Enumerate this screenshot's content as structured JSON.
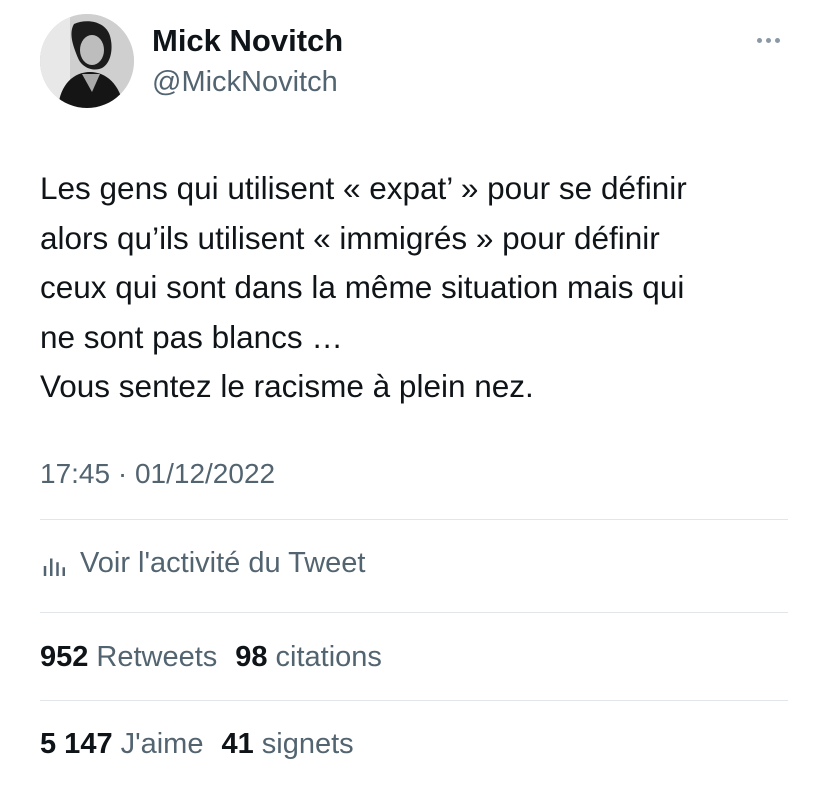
{
  "author": {
    "display_name": "Mick Novitch",
    "handle": "@MickNovitch",
    "avatar_icon": "profile-photo-avatar"
  },
  "more_icon": "more-dots-icon",
  "tweet": {
    "lines": [
      "Les gens qui utilisent « expat’ » pour se définir",
      "alors qu’ils utilisent « immigrés » pour définir",
      "ceux qui sont dans la même situation mais qui",
      "ne sont pas blancs …",
      "Vous sentez le racisme à plein nez."
    ],
    "timestamp": "17:45 · 01/12/2022"
  },
  "activity": {
    "icon": "analytics-bars-icon",
    "label": "Voir l'activité du Tweet"
  },
  "stats": {
    "retweets_count": "952",
    "retweets_label": "Retweets",
    "quotes_count": "98",
    "quotes_label": "citations",
    "likes_count": "5 147",
    "likes_label": "J'aime",
    "bookmarks_count": "41",
    "bookmarks_label": "signets"
  },
  "colors": {
    "text_primary": "#0f1419",
    "text_secondary": "#536471",
    "divider": "#e1e6ea"
  }
}
